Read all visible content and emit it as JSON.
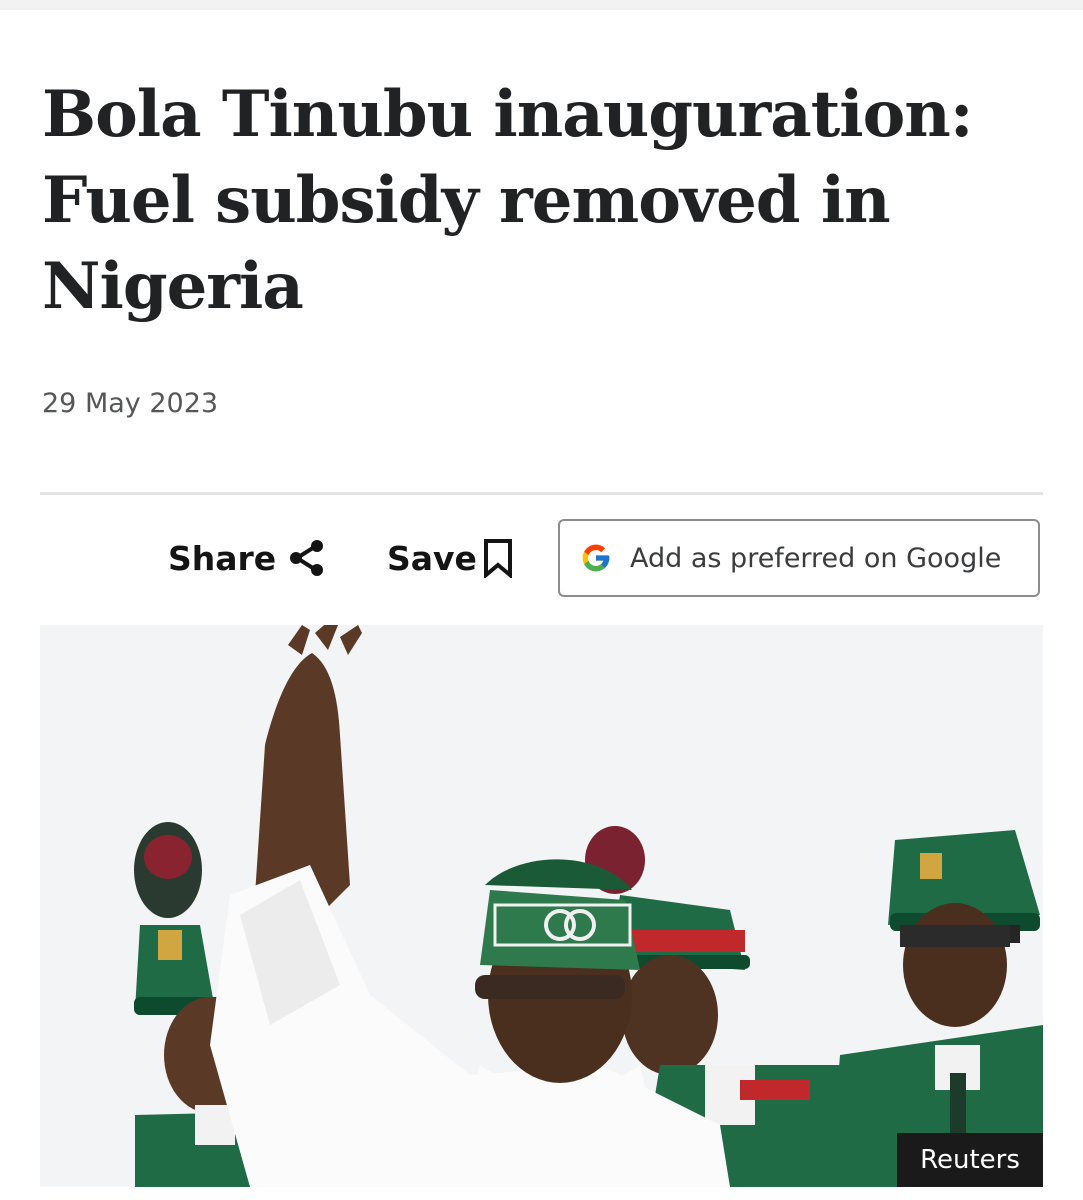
{
  "article": {
    "headline": "Bola Tinubu inauguration: Fuel subsidy removed in Nigeria",
    "date": "29 May 2023"
  },
  "actions": {
    "share_label": "Share",
    "save_label": "Save",
    "google_label": "Add as preferred on Google"
  },
  "hero_image": {
    "credit": "Reuters"
  },
  "icons": [
    "share-icon",
    "bookmark-icon",
    "google-g-icon"
  ],
  "colors": {
    "headline": "#202224",
    "date": "#545658",
    "uniform_green": "#1f6b46",
    "credit_bg": "#1a1a1a"
  }
}
